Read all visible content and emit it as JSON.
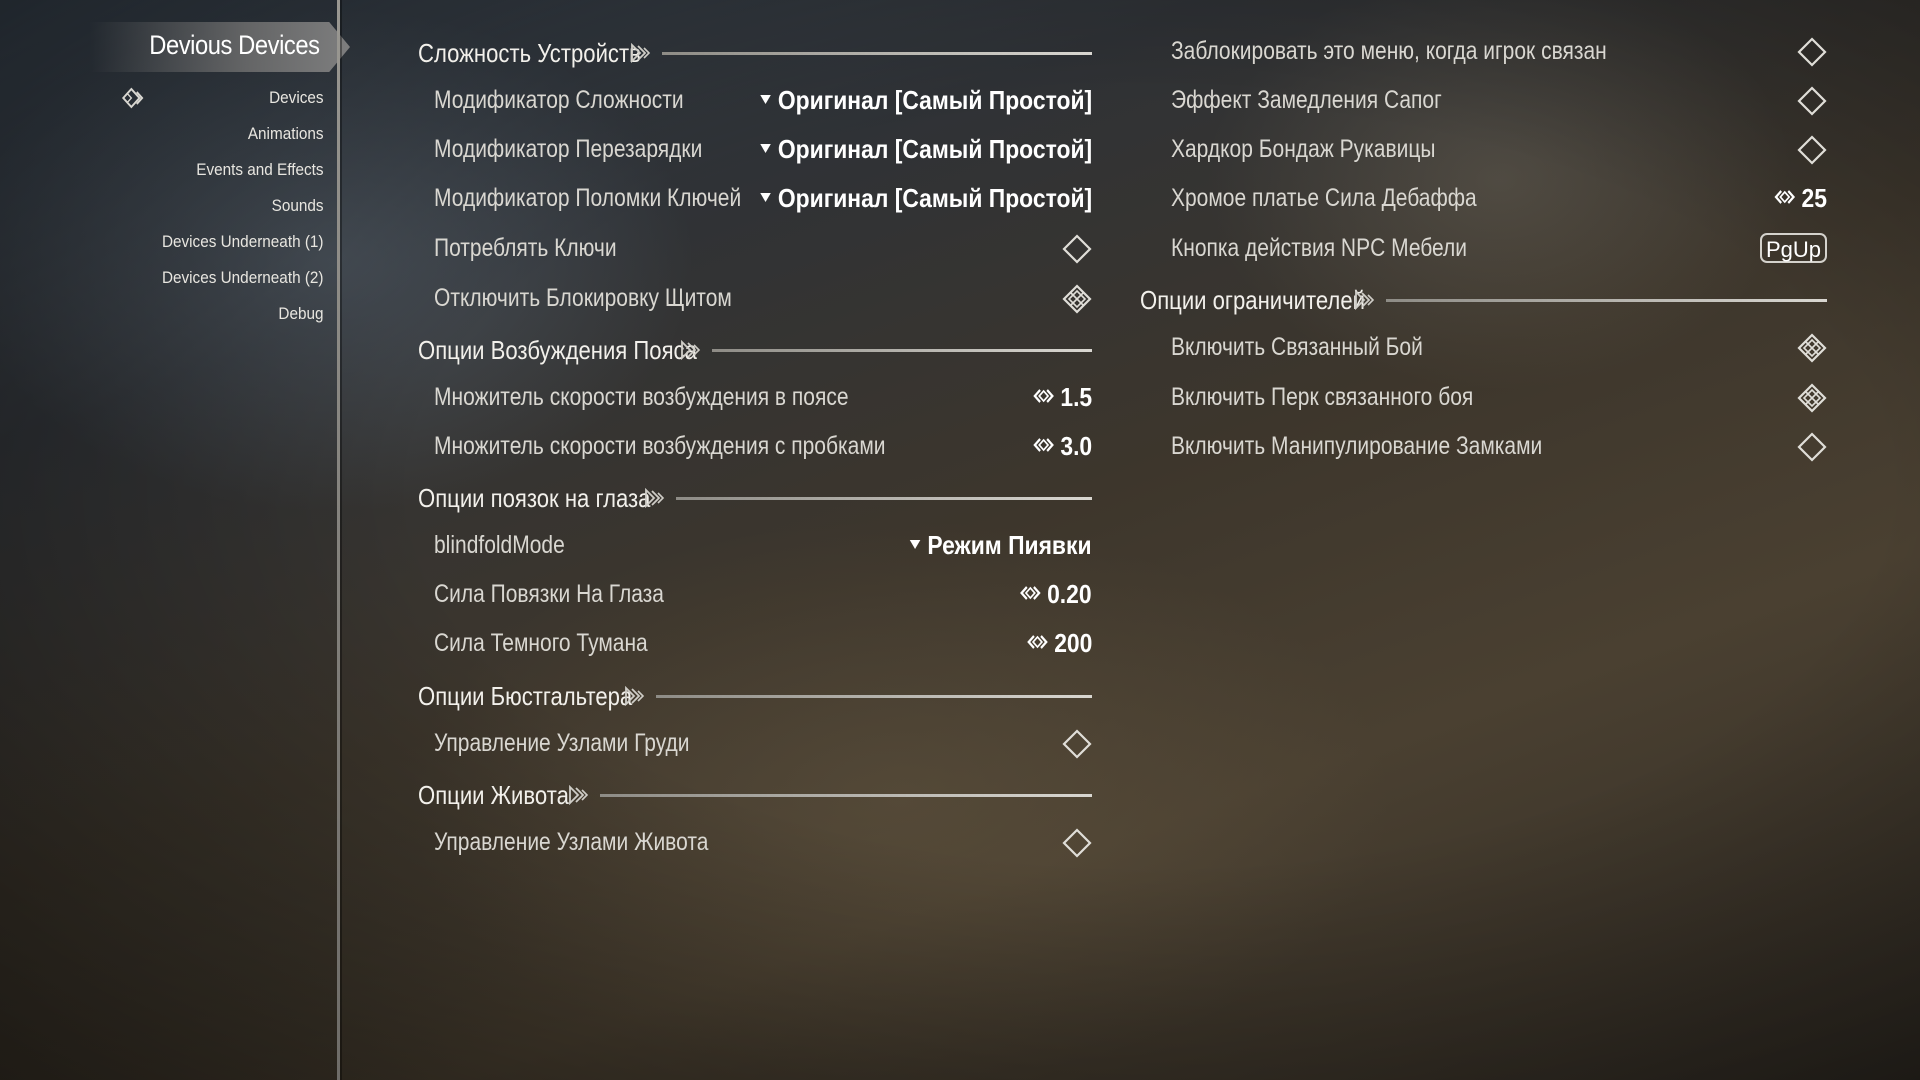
{
  "sidebar": {
    "mod_title": "Devious Devices",
    "pages": [
      {
        "label": "Devices",
        "selected": true
      },
      {
        "label": "Animations"
      },
      {
        "label": "Events and Effects"
      },
      {
        "label": "Sounds"
      },
      {
        "label": "Devices Underneath (1)"
      },
      {
        "label": "Devices Underneath (2)"
      },
      {
        "label": "Debug"
      }
    ]
  },
  "left": {
    "devices_difficulty": {
      "header": "Сложность Устройств",
      "difficulty_mod": {
        "label": "Модификатор Сложности",
        "value": "Оригинал [Самый Простой]"
      },
      "cooldown_mod": {
        "label": "Модификатор Перезарядки",
        "value": "Оригинал [Самый Простой]"
      },
      "keybreak_mod": {
        "label": "Модификатор Поломки Ключей",
        "value": "Оригинал [Самый Простой]"
      },
      "consume_keys": {
        "label": "Потреблять Ключи",
        "checked": false
      },
      "disable_shield_lock": {
        "label": "Отключить Блокировку Щитом",
        "checked": true
      }
    },
    "belt_arousal": {
      "header": "Опции Возбуждения Пояса",
      "belt_rate": {
        "label": "Множитель скорости возбуждения в поясе",
        "value": "1.5"
      },
      "plug_rate": {
        "label": "Множитель скорости возбуждения с пробками",
        "value": "3.0"
      }
    },
    "blindfold": {
      "header": "Опции поязок на глаза",
      "mode": {
        "label": "blindfoldMode",
        "value": "Режим Пиявки"
      },
      "strength": {
        "label": "Сила Повязки На Глаза",
        "value": "0.20"
      },
      "fog": {
        "label": "Сила Темного Тумана",
        "value": "200"
      }
    },
    "bra": {
      "header": "Опции Бюстгальтера",
      "breast_nodes": {
        "label": "Управление Узлами Груди",
        "checked": false
      }
    },
    "belly": {
      "header": "Опции Живота",
      "belly_nodes": {
        "label": "Управление Узлами Живота",
        "checked": false
      }
    }
  },
  "right": {
    "lock_menu": {
      "label": "Заблокировать это меню, когда игрок связан",
      "checked": false
    },
    "boots_slow": {
      "label": "Эффект Замедления Сапог",
      "checked": false
    },
    "hardcore_mittens": {
      "label": "Хардкор Бондаж Рукавицы",
      "checked": false
    },
    "hobble_debuff": {
      "label": "Хромое платье Сила Дебаффа",
      "value": "25"
    },
    "npc_furniture_key": {
      "label": "Кнопка действия NPC Мебели",
      "key": "PgUp"
    },
    "restraints": {
      "header": "Опции ограничителей",
      "bound_combat": {
        "label": "Включить Связанный Бой",
        "checked": true
      },
      "bound_combat_perk": {
        "label": "Включить Перк связанного боя",
        "checked": true
      },
      "lockpicking": {
        "label": "Включить Манипулирование Замками",
        "checked": false
      }
    }
  },
  "colors": {
    "text": "#d9d7d1",
    "value": "#ffffff",
    "line": "#d9d7d1"
  },
  "icons": {
    "toggle_off": "diamond-outline-icon",
    "toggle_on": "diamond-checked-icon",
    "slider": "double-chevron-icon",
    "dropdown": "triangle-down-icon",
    "header_deco": "ornament-icon"
  }
}
